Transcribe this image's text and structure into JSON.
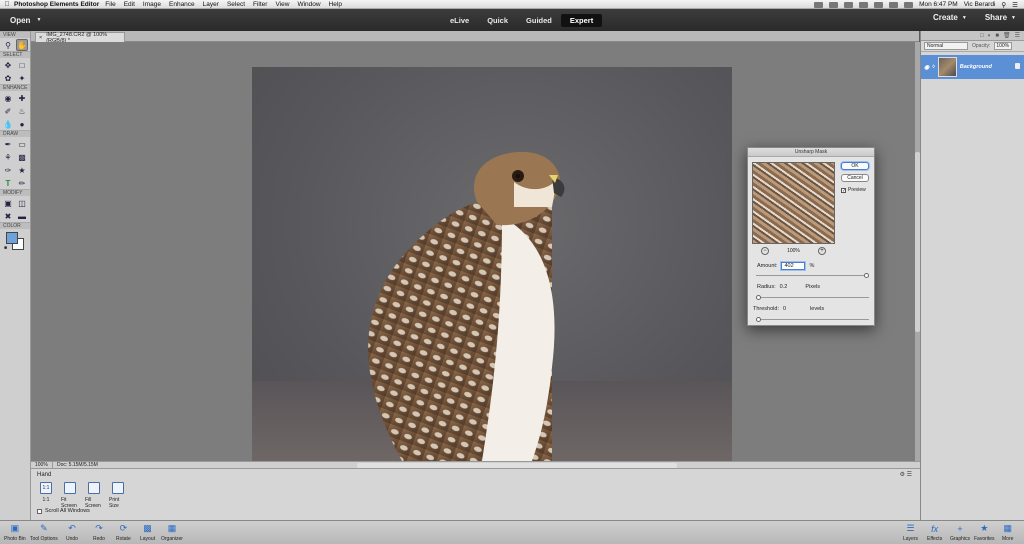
{
  "menubar": {
    "apple": "",
    "app_name": "Photoshop Elements Editor",
    "items": [
      "File",
      "Edit",
      "Image",
      "Enhance",
      "Layer",
      "Select",
      "Filter",
      "View",
      "Window",
      "Help"
    ],
    "clock": "Mon 6:47 PM",
    "user": "Vic Berardi"
  },
  "topbar": {
    "open_label": "Open",
    "modes": [
      "eLive",
      "Quick",
      "Guided",
      "Expert"
    ],
    "active_mode": "Expert",
    "create_label": "Create",
    "share_label": "Share"
  },
  "toolbox": {
    "sections": {
      "view": "VIEW",
      "select": "SELECT",
      "enhance": "ENHANCE",
      "draw": "DRAW",
      "modify": "MODIFY",
      "color": "COLOR"
    },
    "foreground_color": "#6fa3dc",
    "background_color": "#ffffff"
  },
  "document": {
    "tab_label": "IMG_2748.CR2 @ 100% (RGB/8) *",
    "zoom": "100%",
    "doc_size": "Doc: 5.15M/5.15M"
  },
  "tool_options": {
    "tool_name": "Hand",
    "buttons": [
      "1:1",
      "Fit Screen",
      "Fill Screen",
      "Print Size"
    ],
    "button_one_to_one_glyph": "1:1",
    "scroll_all_label": "Scroll All Windows"
  },
  "bottombar": {
    "items": [
      "Photo Bin",
      "Tool Options",
      "Undo",
      "Redo",
      "Rotate",
      "Layout",
      "Organizer",
      "Layers",
      "Effects",
      "Graphics",
      "Favorites",
      "More"
    ]
  },
  "layers_panel": {
    "blend_mode": "Normal",
    "opacity_label": "Opacity:",
    "opacity_value": "100%",
    "layer_name": "Background",
    "highlight_color": "#5b8fd6"
  },
  "dialog": {
    "title": "Unsharp Mask",
    "ok_label": "OK",
    "cancel_label": "Cancel",
    "preview_label": "Preview",
    "preview_checked": true,
    "preview_zoom": "100%",
    "amount_label": "Amount:",
    "amount_value": "402",
    "amount_unit": "%",
    "amount_fraction": 1.0,
    "radius_label": "Radius:",
    "radius_value": "0.2",
    "radius_unit": "Pixels",
    "radius_fraction": 0.0,
    "threshold_label": "Threshold:",
    "threshold_value": "0",
    "threshold_unit": "levels",
    "threshold_fraction": 0.0
  }
}
